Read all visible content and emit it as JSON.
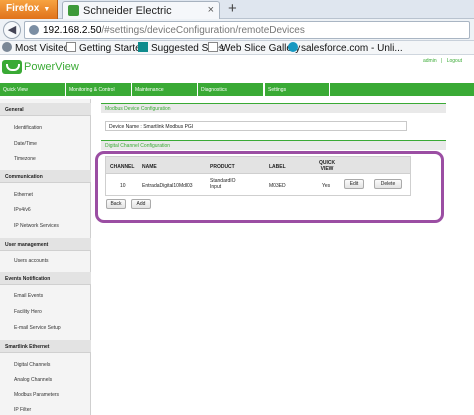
{
  "browser": {
    "menu_label": "Firefox",
    "tab_title": "Schneider Electric",
    "new_tab": "+",
    "url_host": "192.168.2.50",
    "url_path": "/#settings/deviceConfiguration/remoteDevices",
    "bookmarks": [
      {
        "label": "Most Visited",
        "icon": "gear-icon"
      },
      {
        "label": "Getting Started",
        "icon": "page-icon"
      },
      {
        "label": "Suggested Sites",
        "icon": "bing-icon"
      },
      {
        "label": "Web Slice Gallery",
        "icon": "page-icon"
      },
      {
        "label": "salesforce.com - Unli...",
        "icon": "cloud-icon"
      }
    ]
  },
  "app": {
    "title": "PowerView",
    "user": "admin",
    "logout": "Logout"
  },
  "tabs": [
    "Quick View",
    "Monitoring & Control",
    "Maintenance",
    "Diagnostics",
    "Settings"
  ],
  "active_tab": "Settings",
  "sidebar": {
    "groups": [
      {
        "title": "General",
        "items": [
          "Identification",
          "Date/Time",
          "Timezone"
        ]
      },
      {
        "title": "Communication",
        "items": [
          "Ethernet",
          "IPv4/v6",
          "IP Network Services"
        ]
      },
      {
        "title": "User management",
        "items": [
          "Users accounts"
        ]
      },
      {
        "title": "Events Notification",
        "items": [
          "Email Events",
          "Facility Hero",
          "E-mail Service Setup"
        ]
      },
      {
        "title": "Smartlink Ethernet",
        "items": [
          "Digital Channels",
          "Analog Channels",
          "Modbus Parameters",
          "IP Filter"
        ]
      }
    ]
  },
  "modbus_section": {
    "title": "Modbus Device Configuration",
    "device_name_label": "Device Name :",
    "device_name_value": "Smartlink Modbus PGI"
  },
  "channel_section": {
    "title": "Digital Channel Configuration",
    "columns": [
      "CHANNEL",
      "NAME",
      "PRODUCT",
      "LABEL",
      "QUICK VIEW"
    ],
    "rows": [
      {
        "channel": "10",
        "name": "EntradaDigital10Mdl03",
        "product": "StandardIO Input",
        "label": "M03ED",
        "quick_view": "Yes",
        "edit": "Edit",
        "delete": "Delete"
      }
    ],
    "back": "Back",
    "add": "Add"
  },
  "colors": {
    "accent": "#3aaa35",
    "highlight": "#9b4ea3",
    "firefox": "#e87f24"
  }
}
